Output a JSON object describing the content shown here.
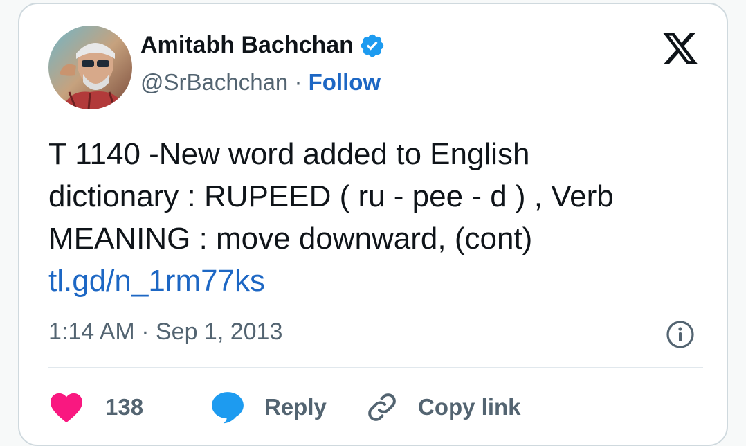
{
  "author": {
    "name": "Amitabh Bachchan",
    "handle": "@SrBachchan",
    "separator": "·",
    "follow_label": "Follow"
  },
  "tweet": {
    "lines": [
      "T 1140 -New word added to English",
      "dictionary : RUPEED ( ru - pee - d ) , Verb",
      "MEANING : move downward, (cont)"
    ],
    "link": "tl.gd/n_1rm77ks"
  },
  "meta": {
    "time": "1:14 AM",
    "separator": "·",
    "date": "Sep 1, 2013"
  },
  "actions": {
    "like_count": "138",
    "reply_label": "Reply",
    "copy_link_label": "Copy link"
  },
  "colors": {
    "accent": "#1d9bf0",
    "link": "#1d67c4",
    "like": "#f91880",
    "text": "#0f1419",
    "muted": "#536471"
  },
  "icons": {
    "logo": "x-logo-icon",
    "verified": "verified-badge-icon",
    "info": "info-icon",
    "like": "heart-icon",
    "reply": "speech-bubble-icon",
    "copy": "link-icon"
  }
}
